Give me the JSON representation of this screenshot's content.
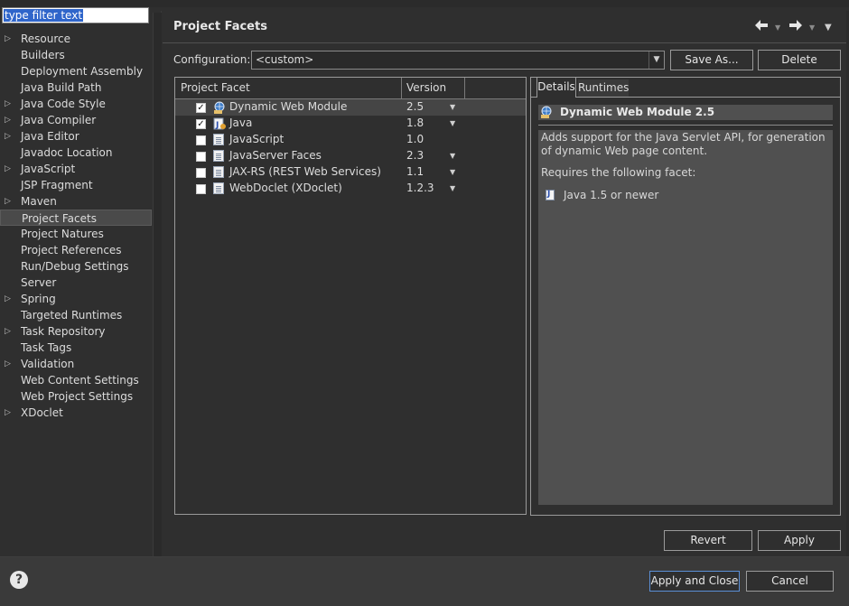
{
  "filter": {
    "placeholder": "type filter text",
    "value": "type filter text"
  },
  "tree": {
    "items": [
      {
        "label": "Resource",
        "expandable": true
      },
      {
        "label": "Builders",
        "expandable": false
      },
      {
        "label": "Deployment Assembly",
        "expandable": false
      },
      {
        "label": "Java Build Path",
        "expandable": false
      },
      {
        "label": "Java Code Style",
        "expandable": true
      },
      {
        "label": "Java Compiler",
        "expandable": true
      },
      {
        "label": "Java Editor",
        "expandable": true
      },
      {
        "label": "Javadoc Location",
        "expandable": false
      },
      {
        "label": "JavaScript",
        "expandable": true
      },
      {
        "label": "JSP Fragment",
        "expandable": false
      },
      {
        "label": "Maven",
        "expandable": true
      },
      {
        "label": "Project Facets",
        "expandable": false,
        "selected": true
      },
      {
        "label": "Project Natures",
        "expandable": false
      },
      {
        "label": "Project References",
        "expandable": false
      },
      {
        "label": "Run/Debug Settings",
        "expandable": false
      },
      {
        "label": "Server",
        "expandable": false
      },
      {
        "label": "Spring",
        "expandable": true
      },
      {
        "label": "Targeted Runtimes",
        "expandable": false
      },
      {
        "label": "Task Repository",
        "expandable": true
      },
      {
        "label": "Task Tags",
        "expandable": false
      },
      {
        "label": "Validation",
        "expandable": true
      },
      {
        "label": "Web Content Settings",
        "expandable": false
      },
      {
        "label": "Web Project Settings",
        "expandable": false
      },
      {
        "label": "XDoclet",
        "expandable": true
      }
    ]
  },
  "page": {
    "title": "Project Facets"
  },
  "icons": {
    "back": "arrow-left-icon",
    "forward": "arrow-right-icon",
    "menu": "chevron-down-icon",
    "help": "help-icon"
  },
  "config": {
    "label": "Configuration:",
    "value": "<custom>",
    "save_as": "Save As...",
    "delete": "Delete"
  },
  "facets": {
    "headers": {
      "facet": "Project Facet",
      "version": "Version"
    },
    "rows": [
      {
        "name": "Dynamic Web Module",
        "version": "2.5",
        "checked": true,
        "has_dropdown": true,
        "selected": true,
        "icon": "web-module-icon"
      },
      {
        "name": "Java",
        "version": "1.8",
        "checked": true,
        "has_dropdown": true,
        "selected": false,
        "icon": "java-icon"
      },
      {
        "name": "JavaScript",
        "version": "1.0",
        "checked": false,
        "has_dropdown": false,
        "selected": false,
        "icon": "document-icon"
      },
      {
        "name": "JavaServer Faces",
        "version": "2.3",
        "checked": false,
        "has_dropdown": true,
        "selected": false,
        "icon": "document-icon"
      },
      {
        "name": "JAX-RS (REST Web Services)",
        "version": "1.1",
        "checked": false,
        "has_dropdown": true,
        "selected": false,
        "icon": "document-icon"
      },
      {
        "name": "WebDoclet (XDoclet)",
        "version": "1.2.3",
        "checked": false,
        "has_dropdown": true,
        "selected": false,
        "icon": "document-icon"
      }
    ]
  },
  "details": {
    "tabs": {
      "details": "Details",
      "runtimes": "Runtimes"
    },
    "header": "Dynamic Web Module 2.5",
    "description": "Adds support for the Java Servlet API, for generation of dynamic Web page content.",
    "requires_label": "Requires the following facet:",
    "requirement": "Java 1.5 or newer"
  },
  "buttons": {
    "revert": "Revert",
    "apply": "Apply",
    "apply_close": "Apply and Close",
    "cancel": "Cancel"
  },
  "colors": {
    "background": "#2f2f2f",
    "selection": "#2f65ca",
    "default_button_border": "#5b8fd6"
  }
}
